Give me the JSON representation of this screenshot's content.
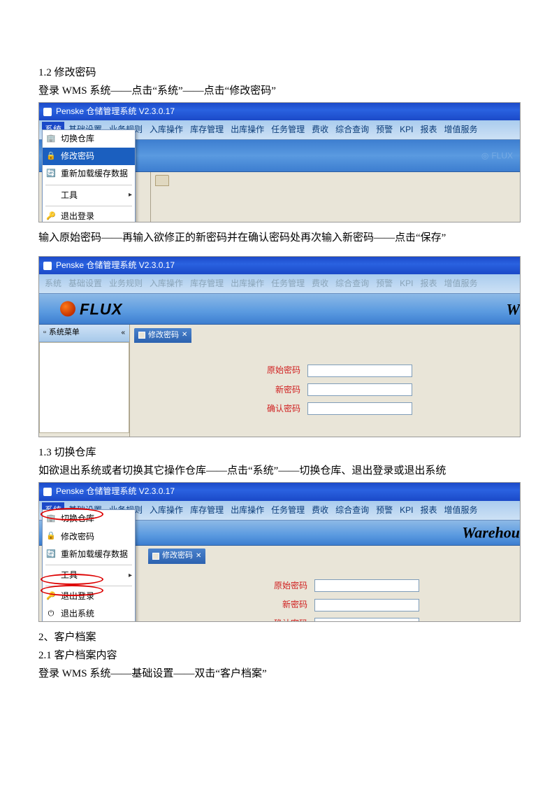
{
  "doc": {
    "sec12_title": "1.2 修改密码",
    "sec12_step1": "登录 WMS 系统——点击“系统”——点击“修改密码”",
    "sec12_step2": "输入原始密码——再输入欲修正的新密码并在确认密码处再次输入新密码——点击“保存”",
    "sec13_title": "1.3 切换仓库",
    "sec13_step1": "如欲退出系统或者切换其它操作仓库——点击“系统”——切换仓库、退出登录或退出系统",
    "sec2_title": "2、客户档案",
    "sec21_title": "2.1 客户档案内容",
    "sec21_step1": "登录 WMS 系统——基础设置——双击“客户档案”"
  },
  "app": {
    "title": "Penske  仓储管理系统  V2.3.0.17",
    "menus": [
      "系统",
      "基础设置",
      "业务规则",
      "入库操作",
      "库存管理",
      "出库操作",
      "任务管理",
      "费收",
      "综合查询",
      "预警",
      "KPI",
      "报表",
      "增值服务"
    ],
    "dropdown": {
      "switch_wh": "切换仓库",
      "change_pw": "修改密码",
      "reload_cache": "重新加载缓存数据",
      "tools": "工具",
      "logout": "退出登录",
      "exit": "退出系统"
    },
    "sidepanel_title": "系统菜单",
    "tab_changepw": "修改密码",
    "fields": {
      "old_pw": "原始密码",
      "new_pw": "新密码",
      "confirm_pw": "确认密码"
    },
    "logo_text": "FLUX",
    "warehouse_text": "Warehou",
    "watermark": "FLUX"
  }
}
